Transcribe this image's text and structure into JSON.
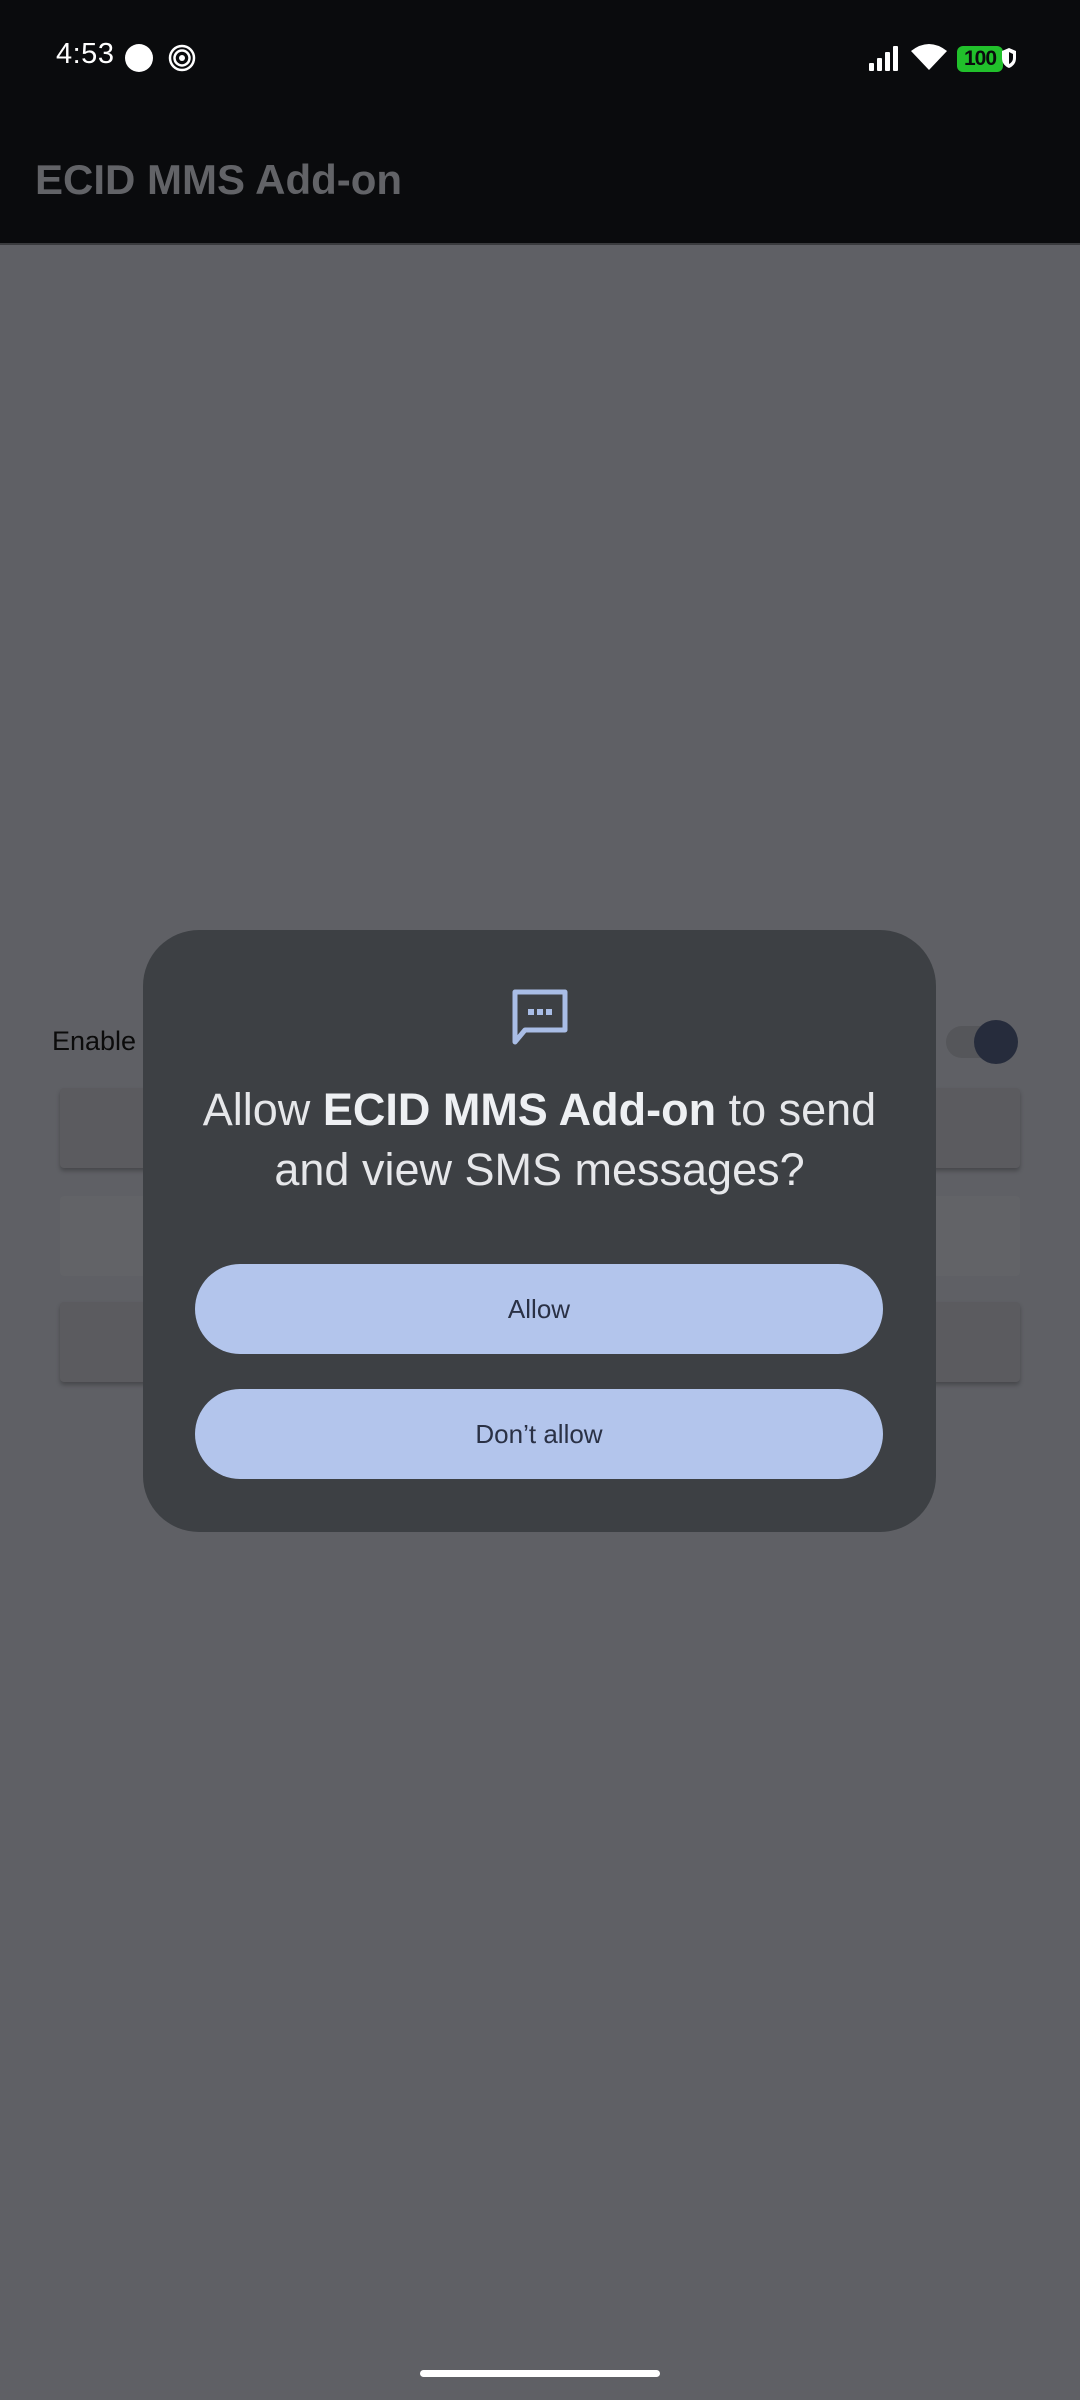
{
  "status_bar": {
    "time": "4:53",
    "battery": "100",
    "icons": [
      "notification-dot-icon",
      "notification-spiral-icon",
      "signal-icon",
      "wifi-icon",
      "battery-icon",
      "shield-icon"
    ],
    "battery_color": "#21c02b"
  },
  "app_bar": {
    "title": "ECID MMS Add-on"
  },
  "main": {
    "setting_label": "Enable M",
    "toggle_on": true
  },
  "dialog": {
    "icon": "sms-message-icon",
    "message_prefix": "Allow ",
    "app_name": "ECID MMS Add-on",
    "message_suffix": " to send and view SMS messages?",
    "allow_label": "Allow",
    "deny_label": "Don’t allow",
    "accent_color": "#b3c5ec"
  }
}
